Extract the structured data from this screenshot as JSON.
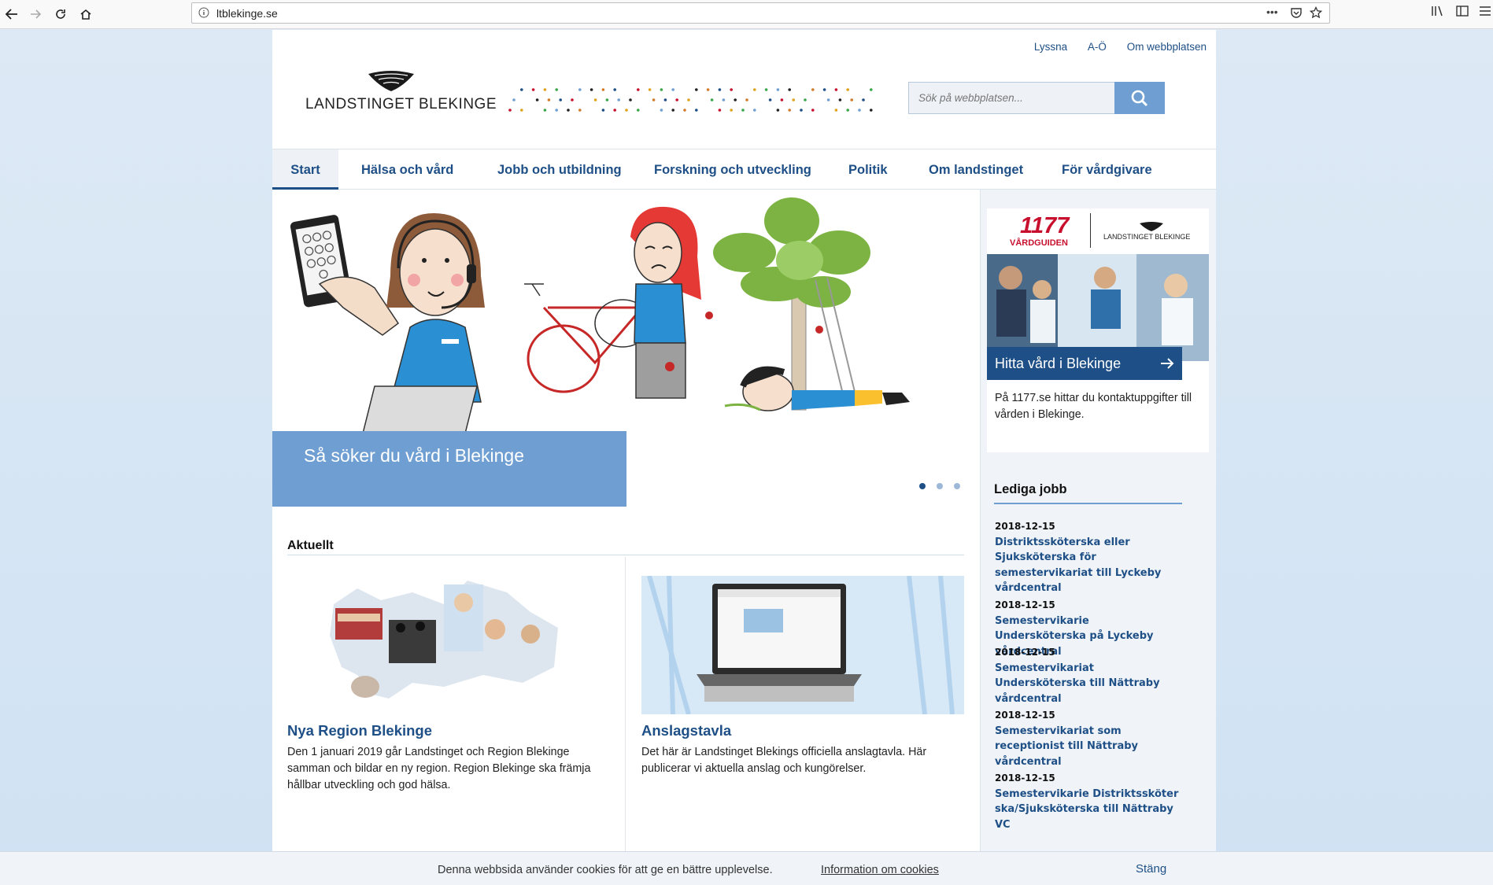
{
  "browser": {
    "url": "ltblekinge.se"
  },
  "site": {
    "logo_text": "LANDSTINGET BLEKINGE",
    "top_links": [
      "Lyssna",
      "A-Ö",
      "Om webbplatsen"
    ],
    "search_placeholder": "Sök på webbplatsen..."
  },
  "mainnav": {
    "items": [
      "Start",
      "Hälsa och vård",
      "Jobb och utbildning",
      "Forskning och utveckling",
      "Politik",
      "Om landstinget",
      "För vårdgivare"
    ],
    "active_index": 0
  },
  "hero": {
    "caption": "Så söker du vård i Blekinge",
    "slides": 3,
    "active_slide": 1
  },
  "news": {
    "heading": "Aktuellt",
    "cards": [
      {
        "title": "Nya Region Blekinge",
        "text": "Den 1 januari 2019 går Landstinget och Region Blekinge samman och bildar en ny region. Region Blekinge ska främja hållbar utveckling och god hälsa."
      },
      {
        "title": "Anslagstavla",
        "text": "Det här är Landstinget Blekings officiella anslagtavla. Här publicerar vi aktuella anslag och kungörelser."
      }
    ]
  },
  "vardguiden": {
    "brand_number": "1177",
    "brand_word": "VÅRDGUIDEN",
    "partner": "LANDSTINGET BLEKINGE",
    "link_label": "Hitta vård i Blekinge",
    "text": "På 1177.se hittar du kontaktuppgifter till vården i Blekinge."
  },
  "jobs": {
    "heading": "Lediga jobb",
    "items": [
      {
        "date": "2018-12-15",
        "title": "Distriktssköterska eller Sjuksköterska för semestervikariat till Lyckeby vårdcentral"
      },
      {
        "date": "2018-12-15",
        "title": "Semestervikarie Undersköterska på Lyckeby vårdcentral"
      },
      {
        "date": "2018-12-15",
        "title": "Semestervikariat Undersköterska till Nättraby vårdcentral"
      },
      {
        "date": "2018-12-15",
        "title": "Semestervikariat som receptionist till Nättraby vårdcentral"
      },
      {
        "date": "2018-12-15",
        "title": "Semestervikarie Distriktssköterska/Sjuksköterska till Nättraby VC"
      }
    ]
  },
  "cookie": {
    "message": "Denna webbsida använder cookies för att ge en bättre upplevelse.",
    "info_link": "Information om cookies",
    "close": "Stäng"
  },
  "colors": {
    "brand_blue": "#1e4f86",
    "accent_blue": "#6f9fd2",
    "vardguiden_red": "#c8102e"
  }
}
